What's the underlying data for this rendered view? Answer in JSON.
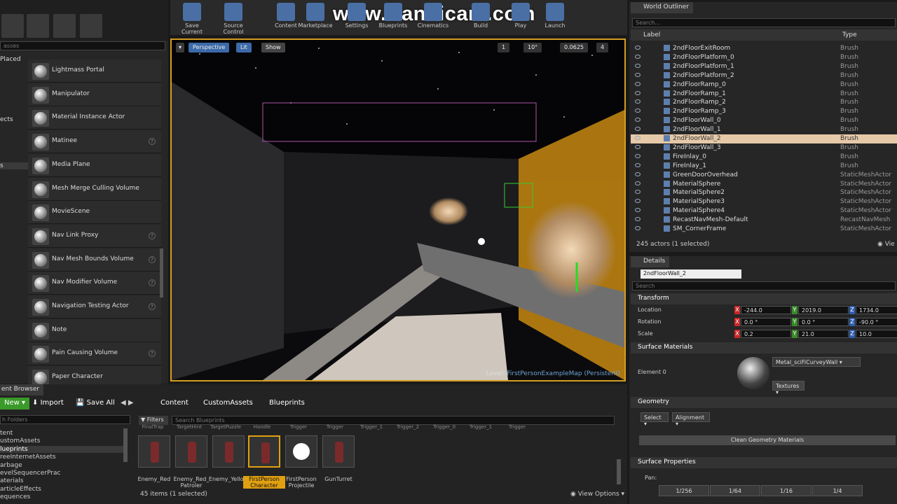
{
  "watermark": "www.Bandicam.com",
  "place": {
    "search_placeholder": "asses",
    "categories": [
      {
        "label": "Placed",
        "name": "placed"
      },
      {
        "label": "ects",
        "name": "effects"
      },
      {
        "label": "s",
        "name": "visual"
      }
    ],
    "items": [
      {
        "label": "Lightmass Portal",
        "help": false
      },
      {
        "label": "Manipulator",
        "help": false
      },
      {
        "label": "Material Instance Actor",
        "help": false
      },
      {
        "label": "Matinee",
        "help": true
      },
      {
        "label": "Media Plane",
        "help": false
      },
      {
        "label": "Mesh Merge Culling Volume",
        "help": false
      },
      {
        "label": "MovieScene",
        "help": false
      },
      {
        "label": "Nav Link Proxy",
        "help": true
      },
      {
        "label": "Nav Mesh Bounds Volume",
        "help": true
      },
      {
        "label": "Nav Modifier Volume",
        "help": true
      },
      {
        "label": "Navigation Testing Actor",
        "help": true
      },
      {
        "label": "Note",
        "help": false
      },
      {
        "label": "Pain Causing Volume",
        "help": true
      },
      {
        "label": "Paper Character",
        "help": false
      }
    ]
  },
  "toolbar": {
    "buttons": [
      "Save Current",
      "Source Control",
      "Content",
      "Marketplace",
      "Settings",
      "Blueprints",
      "Cinematics",
      "Build",
      "Play",
      "Launch"
    ]
  },
  "viewport": {
    "perspective": "Perspective",
    "lit": "Lit",
    "show": "Show",
    "grid_value": "1",
    "angle": "10°",
    "scale": "0.0625",
    "camera_speed": "4",
    "level_prefix": "Level:",
    "level_name": "FirstPersonExampleMap (Persistent)"
  },
  "outliner": {
    "tab": "World Outliner",
    "search_placeholder": "Search...",
    "col_label": "Label",
    "col_type": "Type",
    "rows": [
      {
        "label": "2ndFloorExitRoom",
        "type": "Brush",
        "selected": false
      },
      {
        "label": "2ndFloorPlatform_0",
        "type": "Brush",
        "selected": false
      },
      {
        "label": "2ndFloorPlatform_1",
        "type": "Brush",
        "selected": false
      },
      {
        "label": "2ndFloorPlatform_2",
        "type": "Brush",
        "selected": false
      },
      {
        "label": "2ndFloorRamp_0",
        "type": "Brush",
        "selected": false
      },
      {
        "label": "2ndFloorRamp_1",
        "type": "Brush",
        "selected": false
      },
      {
        "label": "2ndFloorRamp_2",
        "type": "Brush",
        "selected": false
      },
      {
        "label": "2ndFloorRamp_3",
        "type": "Brush",
        "selected": false
      },
      {
        "label": "2ndFloorWall_0",
        "type": "Brush",
        "selected": false
      },
      {
        "label": "2ndFloorWall_1",
        "type": "Brush",
        "selected": false
      },
      {
        "label": "2ndFloorWall_2",
        "type": "Brush",
        "selected": true
      },
      {
        "label": "2ndFloorWall_3",
        "type": "Brush",
        "selected": false
      },
      {
        "label": "FireInlay_0",
        "type": "Brush",
        "selected": false
      },
      {
        "label": "FireInlay_1",
        "type": "Brush",
        "selected": false
      },
      {
        "label": "GreenDoorOverhead",
        "type": "StaticMeshActor",
        "selected": false
      },
      {
        "label": "MaterialSphere",
        "type": "StaticMeshActor",
        "selected": false
      },
      {
        "label": "MaterialSphere2",
        "type": "StaticMeshActor",
        "selected": false
      },
      {
        "label": "MaterialSphere3",
        "type": "StaticMeshActor",
        "selected": false
      },
      {
        "label": "MaterialSphere4",
        "type": "StaticMeshActor",
        "selected": false
      },
      {
        "label": "RecastNavMesh-Default",
        "type": "RecastNavMesh",
        "selected": false
      },
      {
        "label": "SM_CornerFrame",
        "type": "StaticMeshActor",
        "selected": false
      }
    ],
    "status": "245 actors (1 selected)",
    "view_label": "Vie"
  },
  "details": {
    "tab": "Details",
    "name_value": "2ndFloorWall_2",
    "search_placeholder": "Search",
    "transform": "Transform",
    "location_label": "Location",
    "rotation_label": "Rotation",
    "scale_label": "Scale",
    "location": [
      "-244.0",
      "2019.0",
      "1734.0"
    ],
    "rotation": [
      "0.0 °",
      "0.0 °",
      "-90.0 °"
    ],
    "scale": [
      "0.2",
      "21.0",
      "10.0"
    ],
    "surface_materials": "Surface Materials",
    "element0": "Element 0",
    "material": "Metal_sciFiCurveyWall",
    "textures": "Textures",
    "geometry": "Geometry",
    "select": "Select",
    "alignment": "Alignment",
    "clean_geometry": "Clean Geometry Materials",
    "surface_properties": "Surface Properties",
    "pan": "Pan:",
    "pan_values": [
      "1/256",
      "1/64",
      "1/16",
      "1/4"
    ]
  },
  "content_browser": {
    "tab": "ent Browser",
    "add_new": "New",
    "import": "Import",
    "save_all": "Save All",
    "breadcrumbs": [
      "Content",
      "CustomAssets",
      "Blueprints"
    ],
    "folder_search": "h Folders",
    "folders": [
      "tent",
      "ustomAssets",
      "lueprints",
      "reeInternetAssets",
      "arbage",
      "evelSequencerPrac",
      "aterials",
      "articleEffects",
      "equences"
    ],
    "filters": "Filters",
    "asset_search": "Search Blueprints",
    "top_row": [
      "FinalTrap",
      "TargetHint",
      "TargetPuzzle",
      "Handle",
      "Trigger",
      "Trigger",
      "Trigger_1",
      "Trigger_2",
      "Trigger_0",
      "Trigger_1",
      "Trigger"
    ],
    "assets": [
      "Enemy_Red",
      "Enemy_Red_ Patroler",
      "Enemy_Yellow",
      "FirstPerson Character",
      "FirstPerson Projectile",
      "GunTurret"
    ],
    "status": "45 items (1 selected)",
    "view_options": "View Options"
  }
}
